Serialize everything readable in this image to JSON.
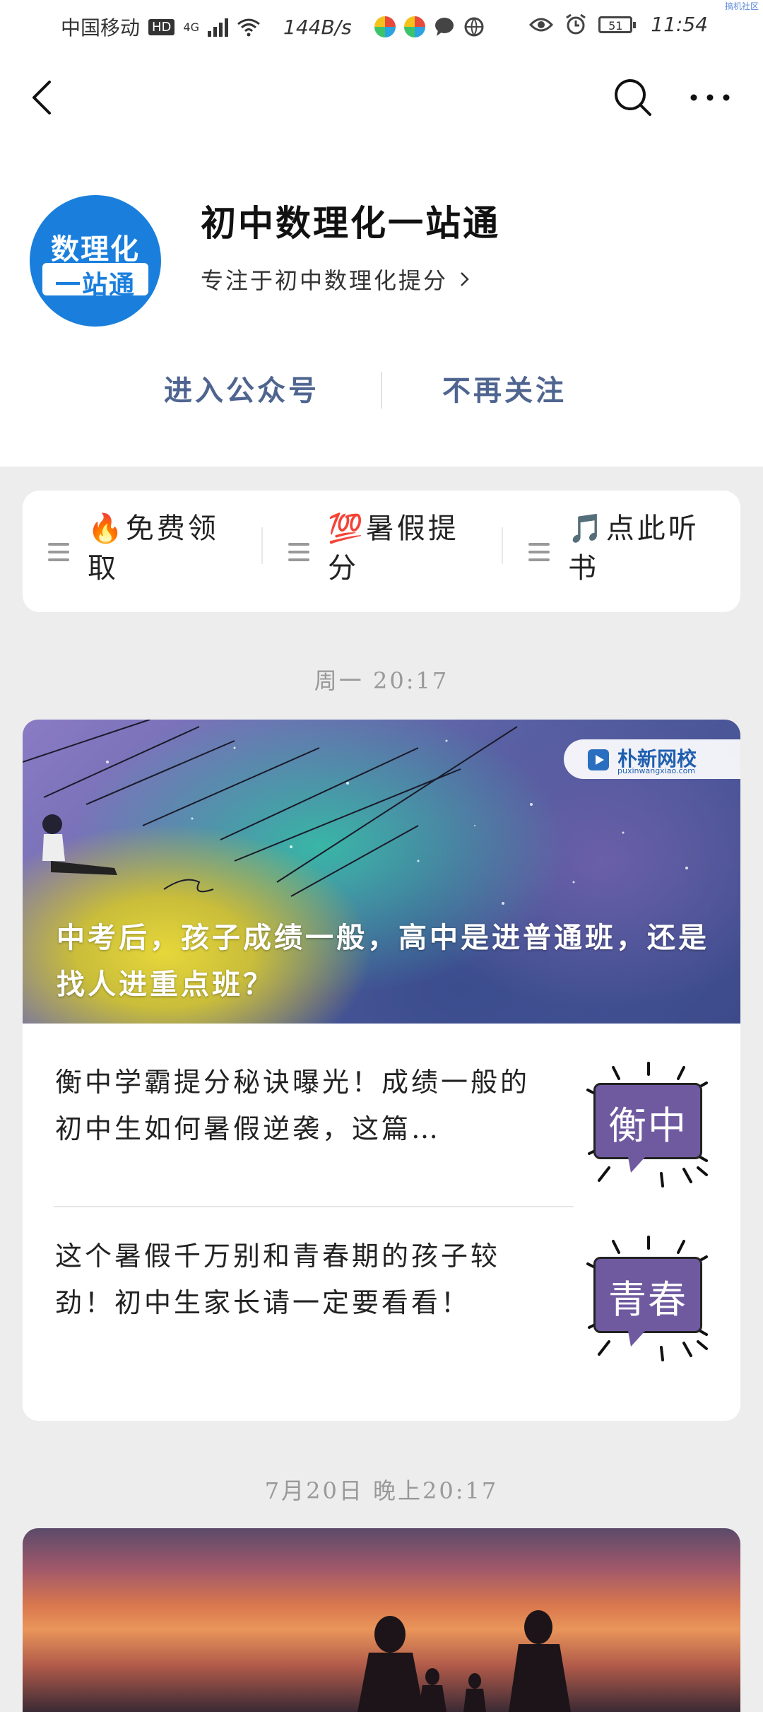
{
  "status_bar": {
    "carrier": "中国移动",
    "hd": "HD",
    "network": "4G",
    "speed": "144B/s",
    "battery": "51",
    "time": "11:54",
    "corner_tag": "搞机社区"
  },
  "nav": {
    "back_icon": "back-chevron-icon",
    "search_icon": "search-icon",
    "more_icon": "more-dots-icon"
  },
  "account": {
    "avatar_line1": "数理化",
    "avatar_line2": "一站通",
    "name": "初中数理化一站通",
    "description": "专注于初中数理化提分"
  },
  "actions": {
    "enter": "进入公众号",
    "unfollow": "不再关注"
  },
  "menu": [
    {
      "label": "🔥免费领取"
    },
    {
      "label": "💯暑假提分"
    },
    {
      "label": "🎵点此听书"
    }
  ],
  "timestamps": {
    "first": "周一 20:17",
    "second": "7月20日 晚上20:17"
  },
  "article_card": {
    "cover_title": "中考后，孩子成绩一般，高中是进普通班，还是找人进重点班？",
    "cover_brand": "朴新网校",
    "cover_brand_url": "puxinwangxiao.com",
    "items": [
      {
        "text": "衡中学霸提分秘诀曝光！成绩一般的初中生如何暑假逆袭，这篇…",
        "thumb_text": "衡中"
      },
      {
        "text": "这个暑假千万别和青春期的孩子较劲！初中生家长请一定要看看！",
        "thumb_text": "青春"
      }
    ]
  }
}
